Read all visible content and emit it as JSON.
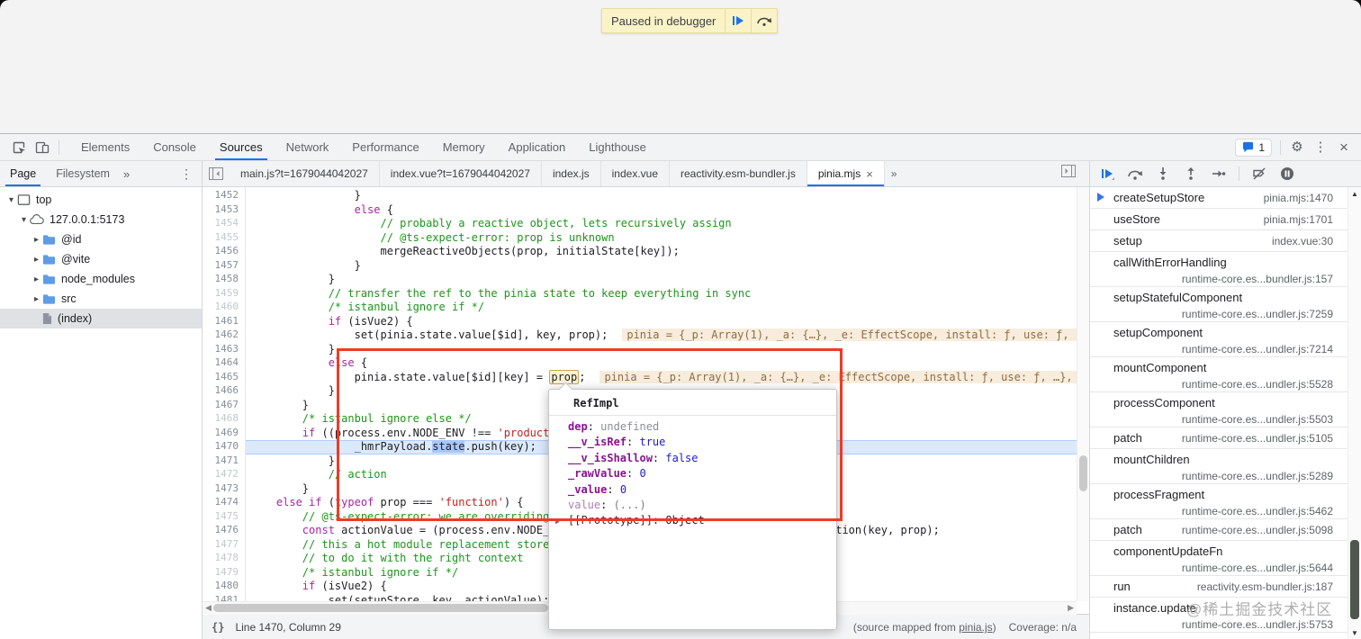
{
  "paused": {
    "label": "Paused in debugger"
  },
  "toolbar": {
    "tabs": [
      "Elements",
      "Console",
      "Sources",
      "Network",
      "Performance",
      "Memory",
      "Application",
      "Lighthouse"
    ],
    "active_tab": "Sources",
    "issues_count": "1"
  },
  "navigator": {
    "tabs": [
      "Page",
      "Filesystem"
    ],
    "active_tab": "Page",
    "overflow": "»",
    "tree": [
      {
        "label": "top",
        "level": 0,
        "caret": "open",
        "icon": "frame"
      },
      {
        "label": "127.0.0.1:5173",
        "level": 1,
        "caret": "open",
        "icon": "cloud"
      },
      {
        "label": "@id",
        "level": 2,
        "caret": "closed",
        "icon": "folder"
      },
      {
        "label": "@vite",
        "level": 2,
        "caret": "closed",
        "icon": "folder"
      },
      {
        "label": "node_modules",
        "level": 2,
        "caret": "closed",
        "icon": "folder"
      },
      {
        "label": "src",
        "level": 2,
        "caret": "closed",
        "icon": "folder"
      },
      {
        "label": "(index)",
        "level": 2,
        "caret": "none",
        "icon": "file",
        "selected": true
      }
    ]
  },
  "file_tabs": {
    "tabs": [
      {
        "label": "main.js?t=1679044042027"
      },
      {
        "label": "index.vue?t=1679044042027"
      },
      {
        "label": "index.js"
      },
      {
        "label": "index.vue"
      },
      {
        "label": "reactivity.esm-bundler.js"
      },
      {
        "label": "pinia.mjs",
        "active": true,
        "closable": true
      }
    ],
    "overflow": "»",
    "close_glyph": "×"
  },
  "debugger_controls": [
    "resume",
    "step-over",
    "step-into",
    "step-out",
    "step",
    "deactivate-breakpoints",
    "pause-on-exceptions"
  ],
  "editor": {
    "lines": [
      {
        "n": 1452,
        "ind": 16,
        "t": [
          [
            "pl",
            "}"
          ]
        ]
      },
      {
        "n": 1453,
        "ind": 16,
        "t": [
          [
            "kw",
            "else"
          ],
          [
            "pl",
            " {"
          ]
        ]
      },
      {
        "n": 1454,
        "ind": 20,
        "t": [
          [
            "cm",
            "// probably a reactive object, lets recursively assign"
          ]
        ]
      },
      {
        "n": 1455,
        "ind": 20,
        "t": [
          [
            "cm",
            "// @ts-expect-error: prop is unknown"
          ]
        ]
      },
      {
        "n": 1456,
        "ind": 20,
        "t": [
          [
            "pl",
            "mergeReactiveObjects(prop, initialState[key]);"
          ]
        ]
      },
      {
        "n": 1457,
        "ind": 16,
        "t": [
          [
            "pl",
            "}"
          ]
        ]
      },
      {
        "n": 1458,
        "ind": 12,
        "t": [
          [
            "pl",
            "}"
          ]
        ]
      },
      {
        "n": 1459,
        "ind": 12,
        "t": [
          [
            "cm",
            "// transfer the ref to the pinia state to keep everything in sync"
          ]
        ]
      },
      {
        "n": 1460,
        "ind": 12,
        "t": [
          [
            "cm",
            "/* istanbul ignore if */"
          ]
        ]
      },
      {
        "n": 1461,
        "ind": 12,
        "t": [
          [
            "kw",
            "if"
          ],
          [
            "pl",
            " (isVue2) {"
          ]
        ]
      },
      {
        "n": 1462,
        "ind": 16,
        "t": [
          [
            "pl",
            "set(pinia.state.value[$id], key, prop);"
          ]
        ],
        "ev": "pinia = {_p: Array(1), _a: {…}, _e: EffectScope, install: ƒ, use: ƒ, "
      },
      {
        "n": 1463,
        "ind": 12,
        "t": [
          [
            "pl",
            "}"
          ]
        ]
      },
      {
        "n": 1464,
        "ind": 12,
        "t": [
          [
            "kw",
            "else"
          ],
          [
            "pl",
            " {"
          ]
        ]
      },
      {
        "n": 1465,
        "ind": 16,
        "t": [
          [
            "pl",
            "pinia.state.value[$id][key] = "
          ],
          [
            "prop",
            "prop"
          ],
          [
            "pl",
            ";"
          ]
        ],
        "ev": "pinia = {_p: Array(1), _a: {…}, _e: EffectScope, install: ƒ, use: ƒ, …},"
      },
      {
        "n": 1466,
        "ind": 12,
        "t": [
          [
            "pl",
            "}"
          ]
        ]
      },
      {
        "n": 1467,
        "ind": 8,
        "t": [
          [
            "pl",
            "}"
          ]
        ]
      },
      {
        "n": 1468,
        "ind": 8,
        "t": [
          [
            "cm",
            "/* istanbul ignore else */"
          ]
        ]
      },
      {
        "n": 1469,
        "ind": 8,
        "t": [
          [
            "kw",
            "if"
          ],
          [
            "pl",
            " ((process.env.NODE_ENV !== "
          ],
          [
            "st",
            "'production'"
          ],
          [
            "pl",
            ")) {"
          ]
        ]
      },
      {
        "n": 1470,
        "ind": 16,
        "cur": true,
        "t": [
          [
            "pl",
            "_hmrPayload."
          ],
          [
            "sel",
            "state"
          ],
          [
            "pl",
            ".push(key);"
          ]
        ]
      },
      {
        "n": 1471,
        "ind": 12,
        "t": [
          [
            "pl",
            "}"
          ]
        ]
      },
      {
        "n": 1472,
        "ind": 12,
        "t": [
          [
            "cm",
            "// action"
          ]
        ]
      },
      {
        "n": 1473,
        "ind": 8,
        "t": [
          [
            "pl",
            "}"
          ]
        ]
      },
      {
        "n": 1474,
        "ind": 4,
        "t": [
          [
            "kw",
            "else"
          ],
          [
            "pl",
            " "
          ],
          [
            "kw",
            "if"
          ],
          [
            "pl",
            " ("
          ],
          [
            "kw",
            "typeof"
          ],
          [
            "pl",
            " prop === "
          ],
          [
            "st",
            "'function'"
          ],
          [
            "pl",
            ") {"
          ]
        ]
      },
      {
        "n": 1475,
        "ind": 8,
        "t": [
          [
            "cm",
            "// @ts-expect-error: we are overriding the function we avoid wrapping if"
          ]
        ]
      },
      {
        "n": 1476,
        "ind": 8,
        "t": [
          [
            "kw",
            "const"
          ],
          [
            "pl",
            " actionValue = (process.env.NODE_ENV !== "
          ],
          [
            "st",
            "'production'"
          ],
          [
            "pl",
            ") && hot ? prop : wrapAction(key, prop);"
          ]
        ]
      },
      {
        "n": 1477,
        "ind": 8,
        "t": [
          [
            "cm",
            "// this a hot module replacement store because the hotUpdate method needs"
          ]
        ]
      },
      {
        "n": 1478,
        "ind": 8,
        "t": [
          [
            "cm",
            "// to do it with the right context"
          ]
        ]
      },
      {
        "n": 1479,
        "ind": 8,
        "t": [
          [
            "cm",
            "/* istanbul ignore if */"
          ]
        ]
      },
      {
        "n": 1480,
        "ind": 8,
        "t": [
          [
            "kw",
            "if"
          ],
          [
            "pl",
            " (isVue2) {"
          ]
        ]
      },
      {
        "n": 1481,
        "ind": 12,
        "t": [
          [
            "pl",
            "set(setupStore, key, actionValue);"
          ]
        ]
      }
    ]
  },
  "tooltip": {
    "title": "RefImpl",
    "entries": [
      {
        "k": "dep",
        "kc": "key",
        "v": "undefined",
        "vc": "muted"
      },
      {
        "k": "__v_isRef",
        "kc": "key",
        "v": "true",
        "vc": "blue"
      },
      {
        "k": "__v_isShallow",
        "kc": "key",
        "v": "false",
        "vc": "blue"
      },
      {
        "k": "_rawValue",
        "kc": "key",
        "v": "0",
        "vc": "blue"
      },
      {
        "k": "_value",
        "kc": "key",
        "v": "0",
        "vc": "blue"
      },
      {
        "k": "value",
        "kc": "getter",
        "v": "(...)",
        "vc": "muted2"
      },
      {
        "k": "[[Prototype]]",
        "kc": "proto",
        "v": "Object",
        "vc": "plain",
        "arrow": true
      }
    ]
  },
  "call_stack": {
    "frames": [
      {
        "name": "createSetupStore",
        "loc": "pinia.mjs:1470",
        "current": true
      },
      {
        "name": "useStore",
        "loc": "pinia.mjs:1701"
      },
      {
        "name": "setup",
        "loc": "index.vue:30"
      },
      {
        "name": "callWithErrorHandling",
        "loc": "runtime-core.es...bundler.js:157"
      },
      {
        "name": "setupStatefulComponent",
        "loc": "runtime-core.es...undler.js:7259"
      },
      {
        "name": "setupComponent",
        "loc": "runtime-core.es...undler.js:7214"
      },
      {
        "name": "mountComponent",
        "loc": "runtime-core.es...undler.js:5528"
      },
      {
        "name": "processComponent",
        "loc": "runtime-core.es...undler.js:5503"
      },
      {
        "name": "patch",
        "loc": "runtime-core.es...undler.js:5105"
      },
      {
        "name": "mountChildren",
        "loc": "runtime-core.es...undler.js:5289"
      },
      {
        "name": "processFragment",
        "loc": "runtime-core.es...undler.js:5462"
      },
      {
        "name": "patch",
        "loc": "runtime-core.es...undler.js:5098"
      },
      {
        "name": "componentUpdateFn",
        "loc": "runtime-core.es...undler.js:5644"
      },
      {
        "name": "run",
        "loc": "reactivity.esm-bundler.js:187"
      },
      {
        "name": "instance.update",
        "loc": "runtime-core.es...undler.js:5753"
      }
    ]
  },
  "status": {
    "brace": "{}",
    "line_col": "Line 1470, Column 29",
    "mapped_prefix": "(source mapped from ",
    "mapped_link": "pinia.js",
    "mapped_suffix": ")",
    "coverage": "Coverage: n/a"
  },
  "watermark": "@稀土掘金技术社区",
  "colors": {
    "accent": "#1a73e8",
    "paused_bg": "#fbf3c8",
    "exec_line_bg": "#dbe9fd",
    "selection": "#a8c7fa",
    "annotation_red": "#ee3b26",
    "keyword": "#a626a4",
    "comment": "#1c961c",
    "string": "#c5221f",
    "inline_eval_bg": "#f8ecdc",
    "object_key": "#881391",
    "value_blue": "#1d1dcd"
  }
}
